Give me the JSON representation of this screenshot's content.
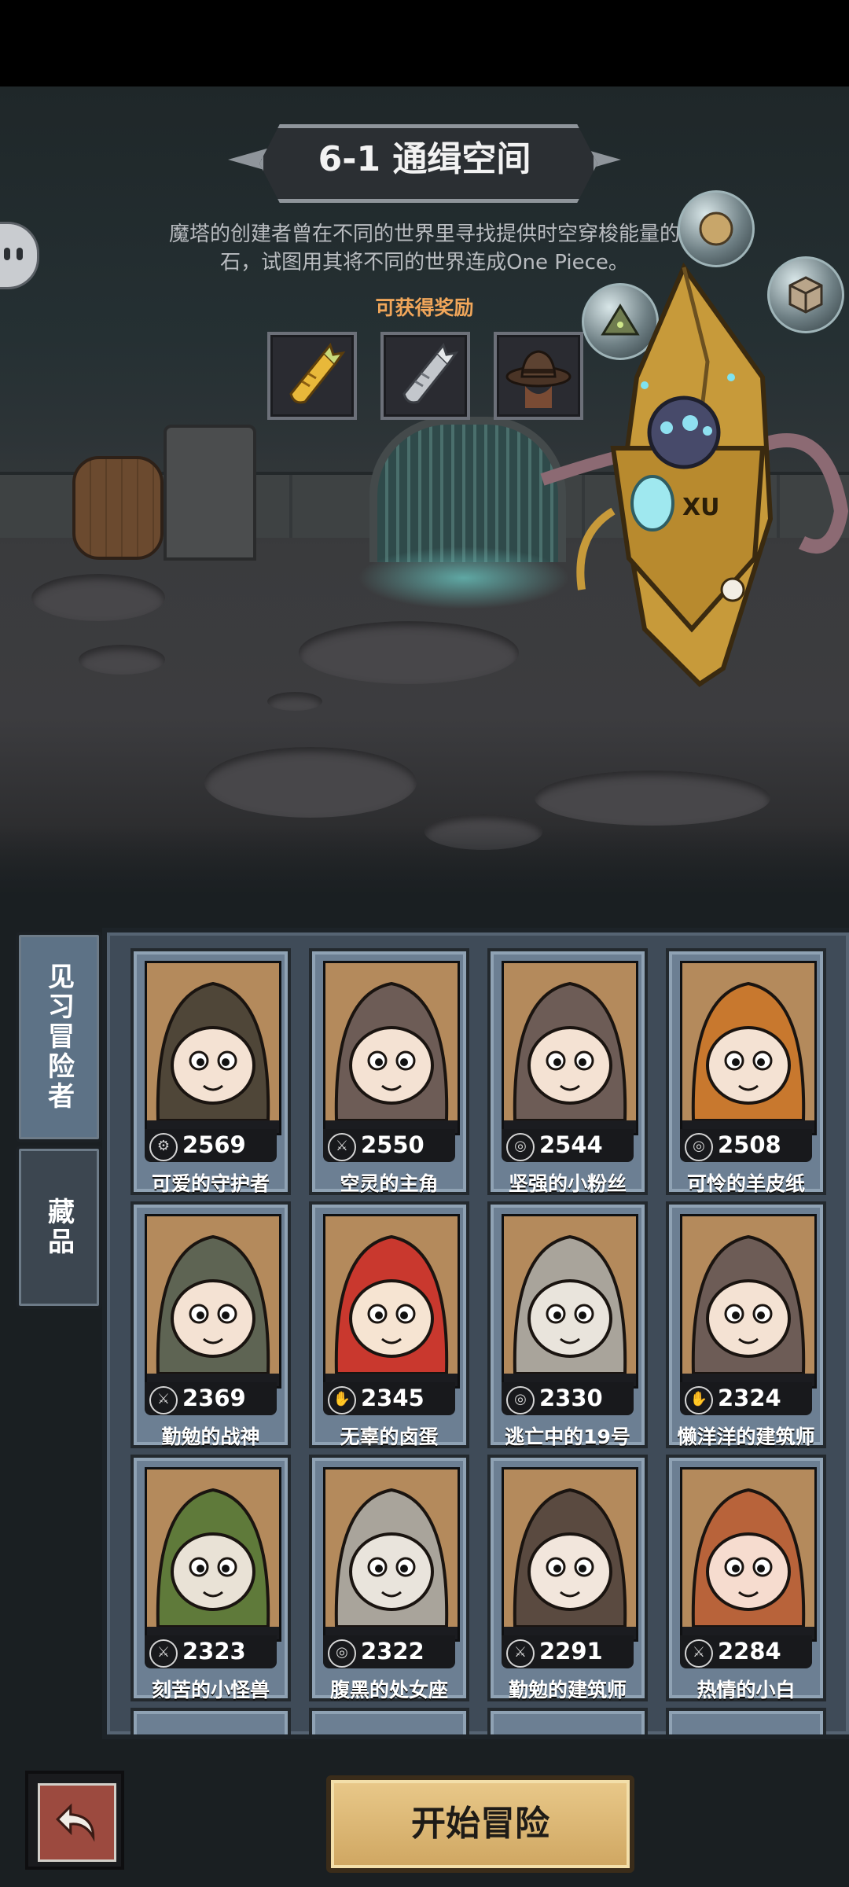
{
  "stage": {
    "title": "6-1 通缉空间",
    "description": "魔塔的创建者曾在不同的世界里寻找提供时空穿梭能量的​石，试图用其将不同的世界连成One Piece。",
    "description_line1": "魔塔的创建者曾在不同的世界里寻找提供时空穿梭能量的",
    "description_line2": "石，试图用其将不同的世界连成One Piece。",
    "rewards_label": "可获得奖励",
    "rewards": [
      "golden-carrot-icon",
      "silver-carrot-icon",
      "cowboy-hat-icon"
    ]
  },
  "boss": {
    "emblem_text": "XU"
  },
  "tabs": [
    {
      "label": "见习冒险者",
      "active": true
    },
    {
      "label": "藏品",
      "active": false
    }
  ],
  "heroes": [
    {
      "name": "可爱的守护者",
      "power": "2569",
      "class_icon": "support-icon"
    },
    {
      "name": "空灵的主角",
      "power": "2550",
      "class_icon": "attack-icon"
    },
    {
      "name": "坚强的小粉丝",
      "power": "2544",
      "class_icon": "target-icon"
    },
    {
      "name": "可怜的羊皮纸",
      "power": "2508",
      "class_icon": "target-icon"
    },
    {
      "name": "勤勉的战神",
      "power": "2369",
      "class_icon": "attack-icon"
    },
    {
      "name": "无辜的卤蛋",
      "power": "2345",
      "class_icon": "heal-icon"
    },
    {
      "name": "逃亡中的19号",
      "power": "2330",
      "class_icon": "target-icon"
    },
    {
      "name": "懒洋洋的建筑师",
      "power": "2324",
      "class_icon": "heal-icon"
    },
    {
      "name": "刻苦的小怪兽",
      "power": "2323",
      "class_icon": "attack-icon"
    },
    {
      "name": "腹黑的处女座",
      "power": "2322",
      "class_icon": "target-icon"
    },
    {
      "name": "勤勉的建筑师",
      "power": "2291",
      "class_icon": "attack-icon"
    },
    {
      "name": "热情的小白",
      "power": "2284",
      "class_icon": "attack-icon"
    }
  ],
  "buttons": {
    "start": "开始冒险",
    "back_icon": "back-arrow-icon"
  }
}
